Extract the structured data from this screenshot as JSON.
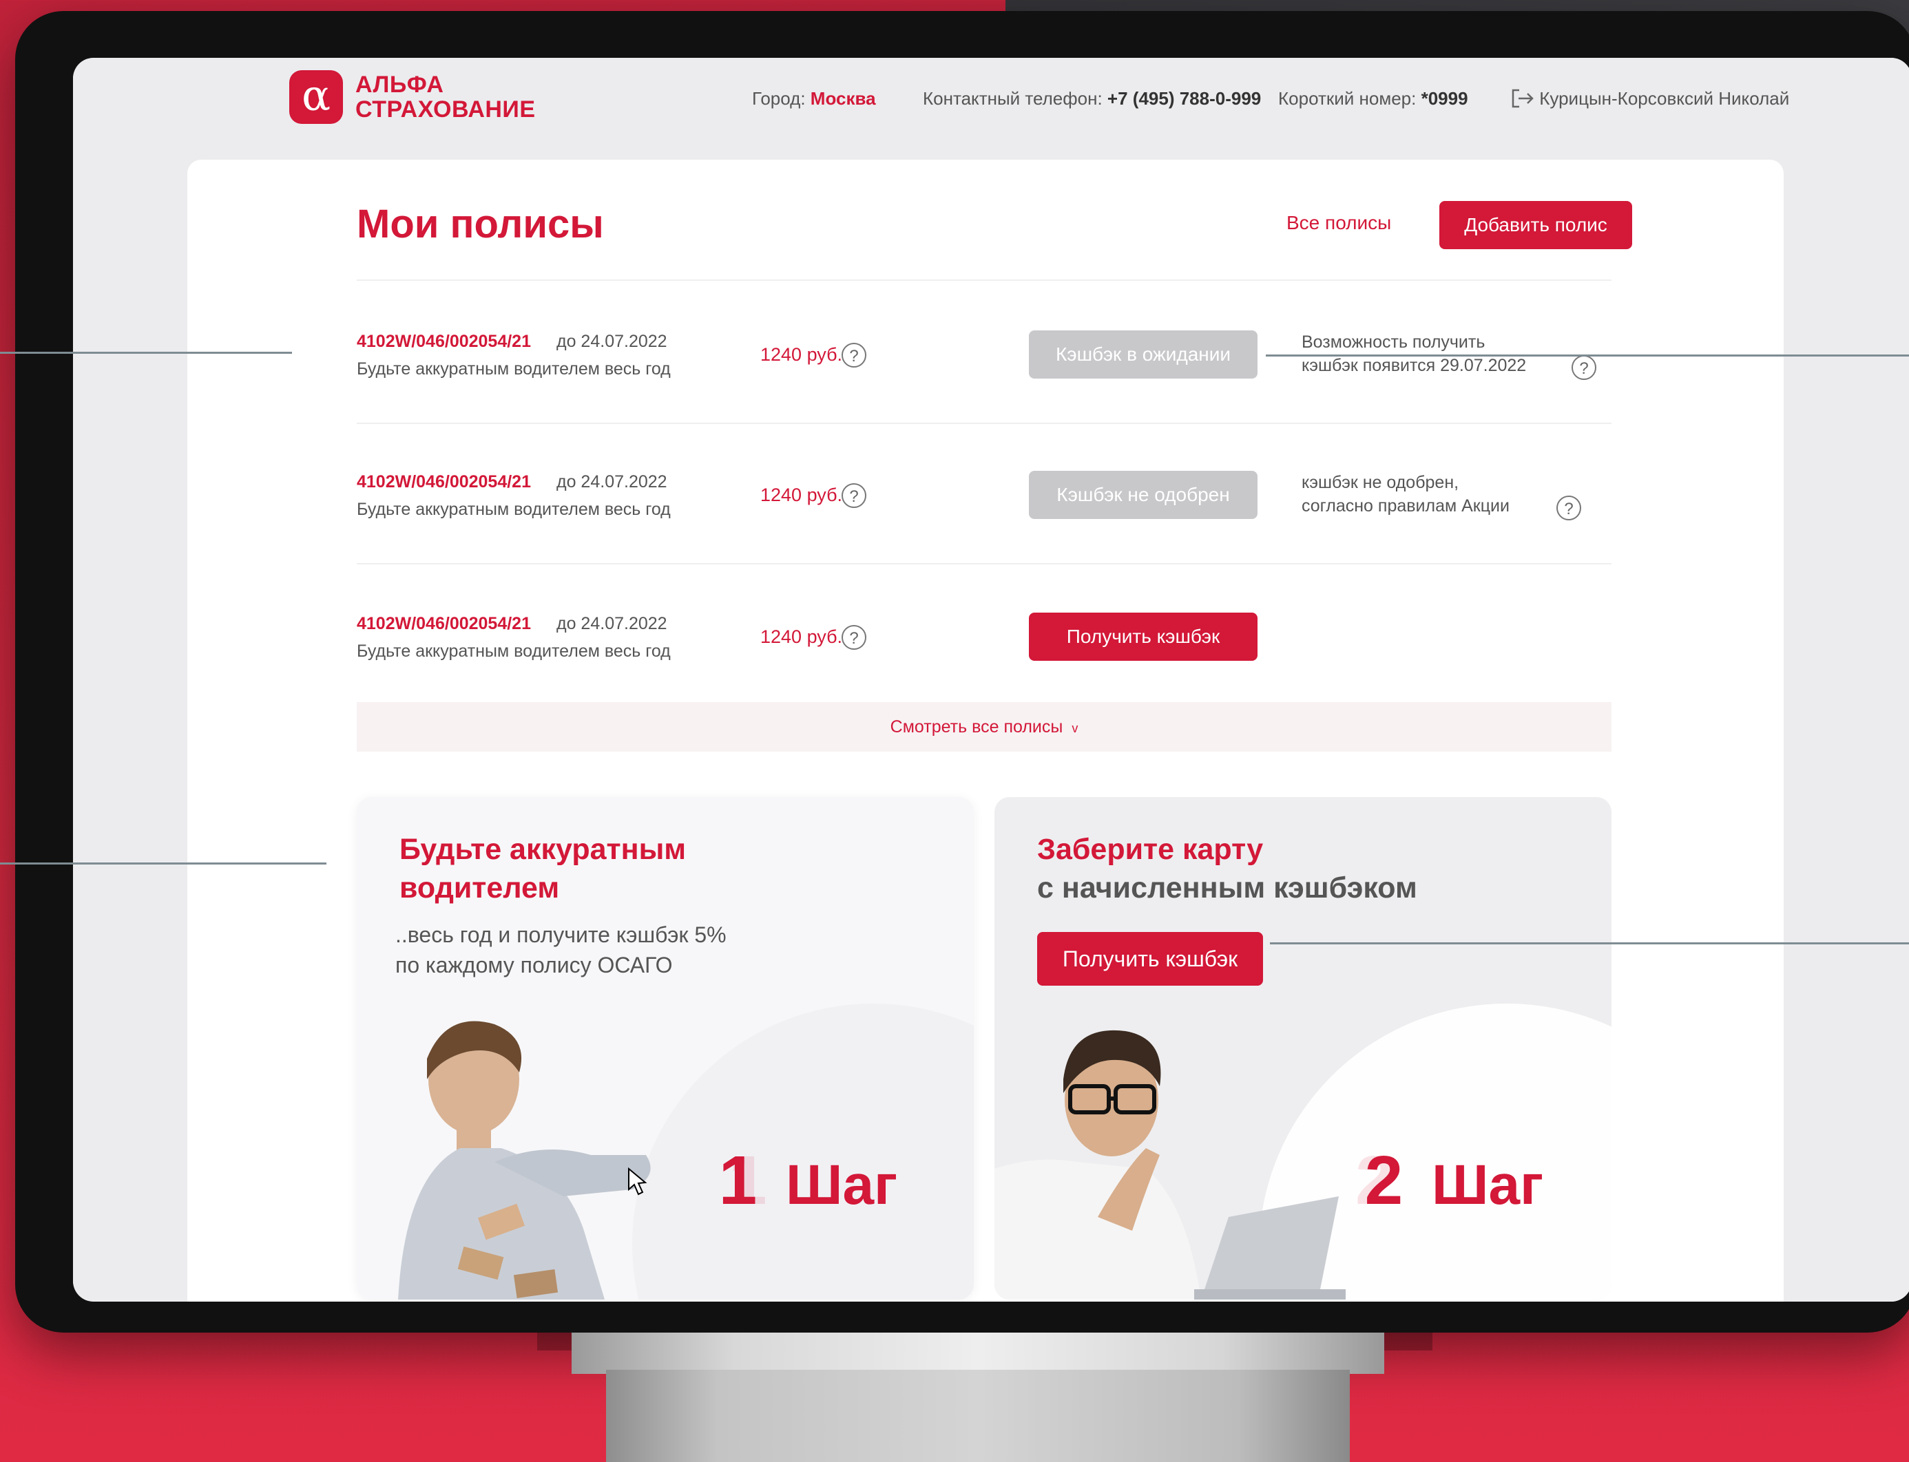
{
  "brand": {
    "logo_symbol": "α",
    "name_line1": "АЛЬФА",
    "name_line2": "СТРАХОВАНИЕ",
    "color": "#d31838"
  },
  "header": {
    "city_label": "Город:",
    "city_value": "Москва",
    "phone_label": "Контактный телефон:",
    "phone_value": "+7 (495) 788-0-999",
    "short_label": "Короткий номер:",
    "short_value": "*0999",
    "user_name": "Курицын-Корсовксий Николай",
    "logout_icon": "logout-icon"
  },
  "page": {
    "title": "Мои полисы",
    "all_policies_link": "Все полисы",
    "add_policy_button": "Добавить полис"
  },
  "policies": [
    {
      "number": "4102W/046/002054/21",
      "valid_until": "до 24.07.2022",
      "description": "Будьте аккуратным водителем весь год",
      "amount": "1240 руб.",
      "status_label": "Кэшбэк в ожидании",
      "status_kind": "disabled",
      "note_line1": "Возможность получить",
      "note_line2": "кэшбэк появится 29.07.2022"
    },
    {
      "number": "4102W/046/002054/21",
      "valid_until": "до 24.07.2022",
      "description": "Будьте аккуратным водителем весь год",
      "amount": "1240 руб.",
      "status_label": "Кэшбэк не одобрен",
      "status_kind": "disabled",
      "note_line1": "кэшбэк не одобрен,",
      "note_line2": "согласно правилам Акции"
    },
    {
      "number": "4102W/046/002054/21",
      "valid_until": "до 24.07.2022",
      "description": "Будьте аккуратным водителем весь год",
      "amount": "1240 руб.",
      "status_label": "Получить кэшбэк",
      "status_kind": "active"
    }
  ],
  "view_all": "Смотреть все полисы",
  "view_all_icon": "chevron-down-icon",
  "promo1": {
    "title_line1": "Будьте аккуратным",
    "title_line2": "водителем",
    "sub_line1": "..весь год и получите кэшбэк 5%",
    "sub_line2": "по каждому полису ОСАГО",
    "step_number": "1",
    "step_word": "Шаг"
  },
  "promo2": {
    "title_line1": "Заберите карту",
    "title_line2": "с начисленным кэшбэком",
    "button": "Получить кэшбэк",
    "step_number": "2",
    "step_word": "Шаг"
  }
}
